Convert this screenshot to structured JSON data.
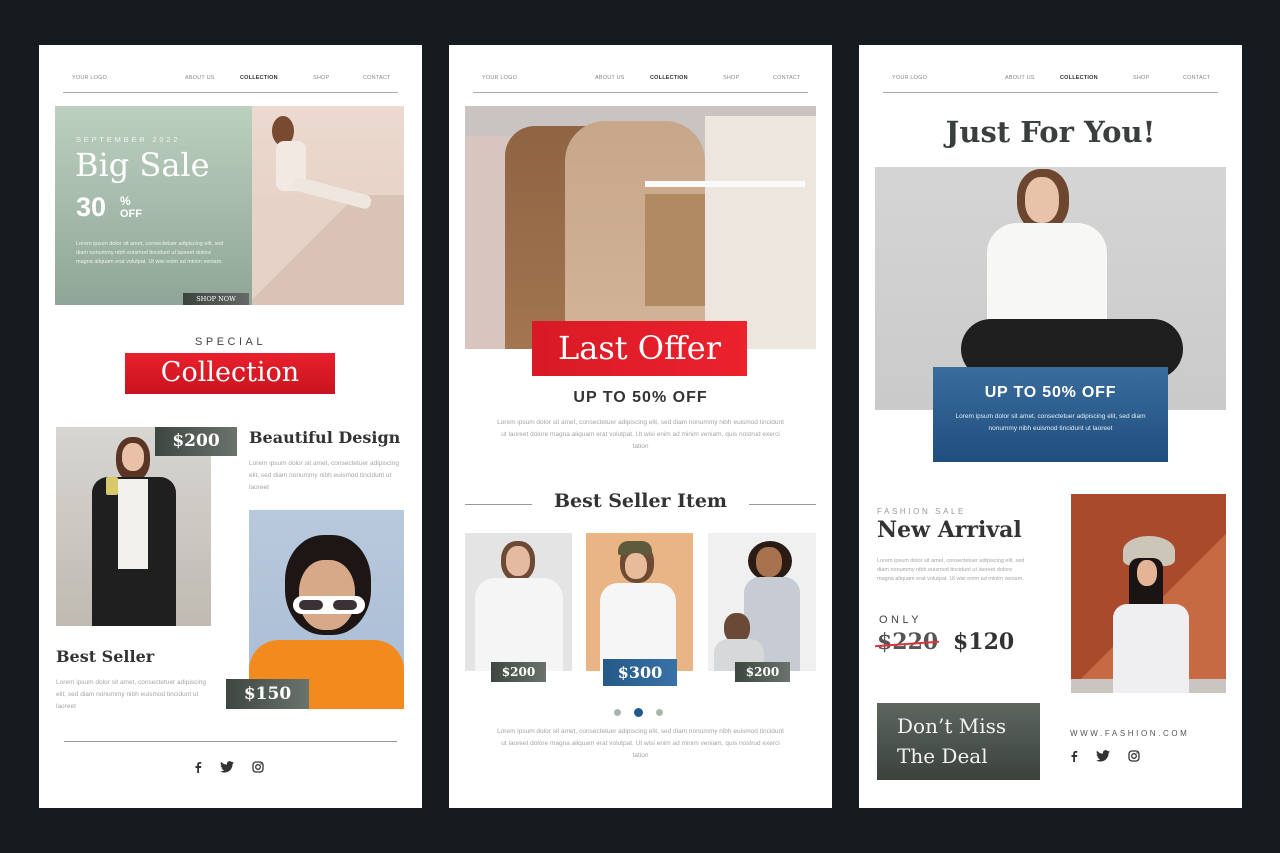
{
  "nav": {
    "logo": "YOUR LOGO",
    "items": [
      "ABOUT US",
      "COLLECTION",
      "SHOP",
      "CONTACT"
    ],
    "active": "COLLECTION"
  },
  "colors": {
    "background": "#161b1f",
    "red": "#e41f2b",
    "blue": "#2a5f8f",
    "dark_green": "#4a524d",
    "sage": "#9bb0a1"
  },
  "card1": {
    "hero": {
      "eyebrow": "SEPTEMBER 2022",
      "title": "Big Sale",
      "percent": "30",
      "percent_sign": "%",
      "off": "OFF",
      "body": "Lorem ipsum dolor sit amet, consectetuer adipiscing elit, sed diam nonummy nibh euismod tincidunt ut laoreet dolore magna aliquam erat volutpat. Ut wisi enim ad minim veniam.",
      "cta": "SHOP NOW"
    },
    "special_label": "SPECIAL",
    "collection_label": "Collection",
    "product1": {
      "price": "$200",
      "title": "Beautiful Design",
      "body": "Lorem ipsum dolor sit amet, consectetuer adipiscing elit, sed diam nonummy nibh euismod tincidunt ut laoreet"
    },
    "product2": {
      "price": "$150",
      "title": "Best Seller",
      "body": "Lorem ipsum dolor sit amet, consectetuer adipiscing elit, sed diam nonummy nibh euismod tincidunt ut laoreet"
    },
    "social_icons": [
      "facebook-icon",
      "twitter-icon",
      "instagram-icon"
    ]
  },
  "card2": {
    "hero_label": "Last Offer",
    "discount": "UP TO 50% OFF",
    "body": "Lorem ipsum dolor sit amet, consectetuer adipiscing elit, sed diam nonummy nibh euismod tincidunt ut laoreet dolore magna aliquam erat volutpat. Ut wisi enim ad minim veniam, quis nostrud exerci tation",
    "section_title": "Best Seller Item",
    "items": [
      {
        "price": "$200"
      },
      {
        "price": "$300"
      },
      {
        "price": "$200"
      }
    ],
    "carousel": {
      "count": 3,
      "active_index": 1
    },
    "footer_body": "Lorem ipsum dolor sit amet, consectetuer adipiscing elit, sed diam nonummy nibh euismod tincidunt ut laoreet dolore magna aliquam erat volutpat. Ut wisi enim ad minim veniam, quis nostrud exerci tation"
  },
  "card3": {
    "title": "Just For You!",
    "discount": "UP TO 50% OFF",
    "discount_body": "Lorem ipsum dolor sit amet, consectetuer adipiscing elit, sed diam nonummy nibh euismod tincidunt ut laoreet",
    "eyebrow": "FASHION SALE",
    "arrival_title": "New Arrival",
    "arrival_body": "Lorem ipsum dolor sit amet, consectetuer adipiscing elit, sed diam nonummy nibh euismod tincidunt ut laoreet dolore magna aliquam erat volutpat. Ut wisi enim ad minim veniam.",
    "only_label": "ONLY",
    "old_price": "$220",
    "new_price": "$120",
    "cta_line1": "Don’t Miss",
    "cta_line2": "The Deal",
    "website": "WWW.FASHION.COM"
  }
}
